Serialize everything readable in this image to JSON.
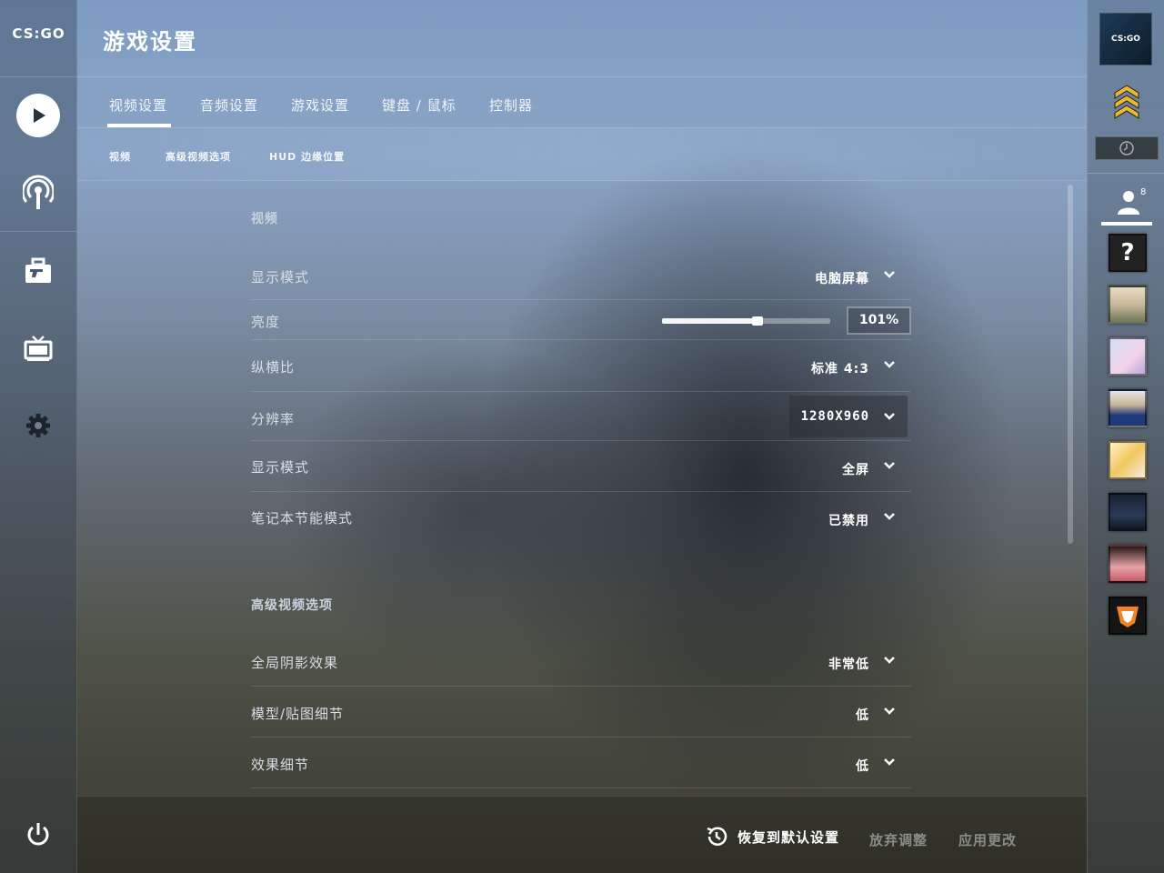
{
  "app": {
    "logo_text": "CS:GO"
  },
  "header": {
    "title": "游戏设置"
  },
  "tabs": [
    {
      "label": "视频设置",
      "active": true
    },
    {
      "label": "音频设置"
    },
    {
      "label": "游戏设置"
    },
    {
      "label": "键盘 / 鼠标"
    },
    {
      "label": "控制器"
    }
  ],
  "subtabs": [
    {
      "label": "视频"
    },
    {
      "label": "高级视频选项"
    },
    {
      "label": "HUD 边缘位置"
    }
  ],
  "sections": {
    "video": {
      "title": "视频",
      "rows": [
        {
          "label": "显示模式",
          "value": "电脑屏幕"
        },
        {
          "label": "亮度",
          "percent_text": "101%",
          "slider_fraction": 0.57
        },
        {
          "label": "纵横比",
          "value": "标准 4:3"
        },
        {
          "label": "分辨率",
          "value": "1280X960"
        },
        {
          "label": "显示模式",
          "value": "全屏"
        },
        {
          "label": "笔记本节能模式",
          "value": "已禁用"
        }
      ]
    },
    "advanced": {
      "title": "高级视频选项",
      "rows": [
        {
          "label": "全局阴影效果",
          "value": "非常低"
        },
        {
          "label": "模型/贴图细节",
          "value": "低"
        },
        {
          "label": "效果细节",
          "value": "低"
        }
      ]
    }
  },
  "footer": {
    "reset_label": "恢复到默认设置",
    "discard_label": "放弃调整",
    "apply_label": "应用更改"
  },
  "right_bar": {
    "friends_count": "8",
    "unknown_avatar": "?"
  },
  "icons": {
    "left_nav": [
      "play-icon",
      "broadcast-icon",
      "inventory-icon",
      "tv-icon",
      "gear-icon",
      "power-icon"
    ],
    "footer": [
      "history-icon",
      "chevron-down-icon"
    ]
  },
  "colors": {
    "accent": "#ffffff",
    "disabled_text": "#8a8d86"
  }
}
